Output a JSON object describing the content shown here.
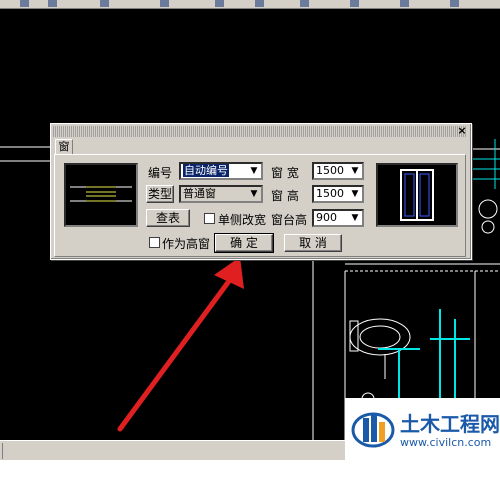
{
  "dialog": {
    "tab_label": "窗",
    "close_glyph": "×",
    "number_label": "编号",
    "number_value": "自动编号",
    "type_button": "类型",
    "type_value": "普通窗",
    "lookup_button": "查表",
    "single_side_label": "单侧改宽",
    "high_window_label": "作为高窗",
    "width_label": "窗 宽",
    "width_value": "1500",
    "height_label": "窗 高",
    "height_value": "1500",
    "sill_label": "窗台高",
    "sill_value": "900",
    "ok_button": "确 定",
    "cancel_button": "取 消"
  },
  "watermark": {
    "title": "土木工程网",
    "url": "www.civilcn.com"
  },
  "colors": {
    "arrow": "#e02020",
    "cad_cyan": "#00e5e5",
    "cad_white": "#ffffff"
  }
}
